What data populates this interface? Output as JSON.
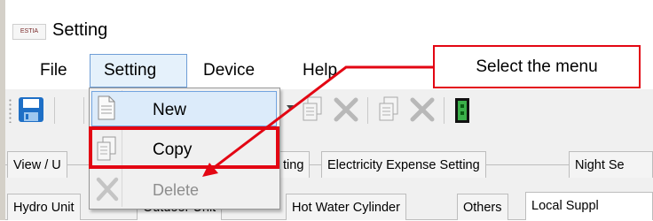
{
  "window": {
    "title": "Setting",
    "logo_text": "ESTIA"
  },
  "menubar": {
    "items": [
      "File",
      "Setting",
      "Device",
      "Help"
    ]
  },
  "dropdown": {
    "new_label": "New",
    "copy_label": "Copy",
    "delete_label": "Delete"
  },
  "tabs_row1": [
    "View / U",
    "ting",
    "Electricity Expense Setting",
    "Night Se"
  ],
  "tabs_row2": [
    "Hydro Unit",
    "Outdoor Unit",
    "Hot Water Cylinder",
    "Others",
    "Local Suppl"
  ],
  "annotation": {
    "callout_text": "Select the menu",
    "accent_color": "#e30613"
  },
  "icons": [
    "save-icon",
    "new-document-icon",
    "copy-document-icon",
    "delete-x-icon",
    "device-icon"
  ]
}
